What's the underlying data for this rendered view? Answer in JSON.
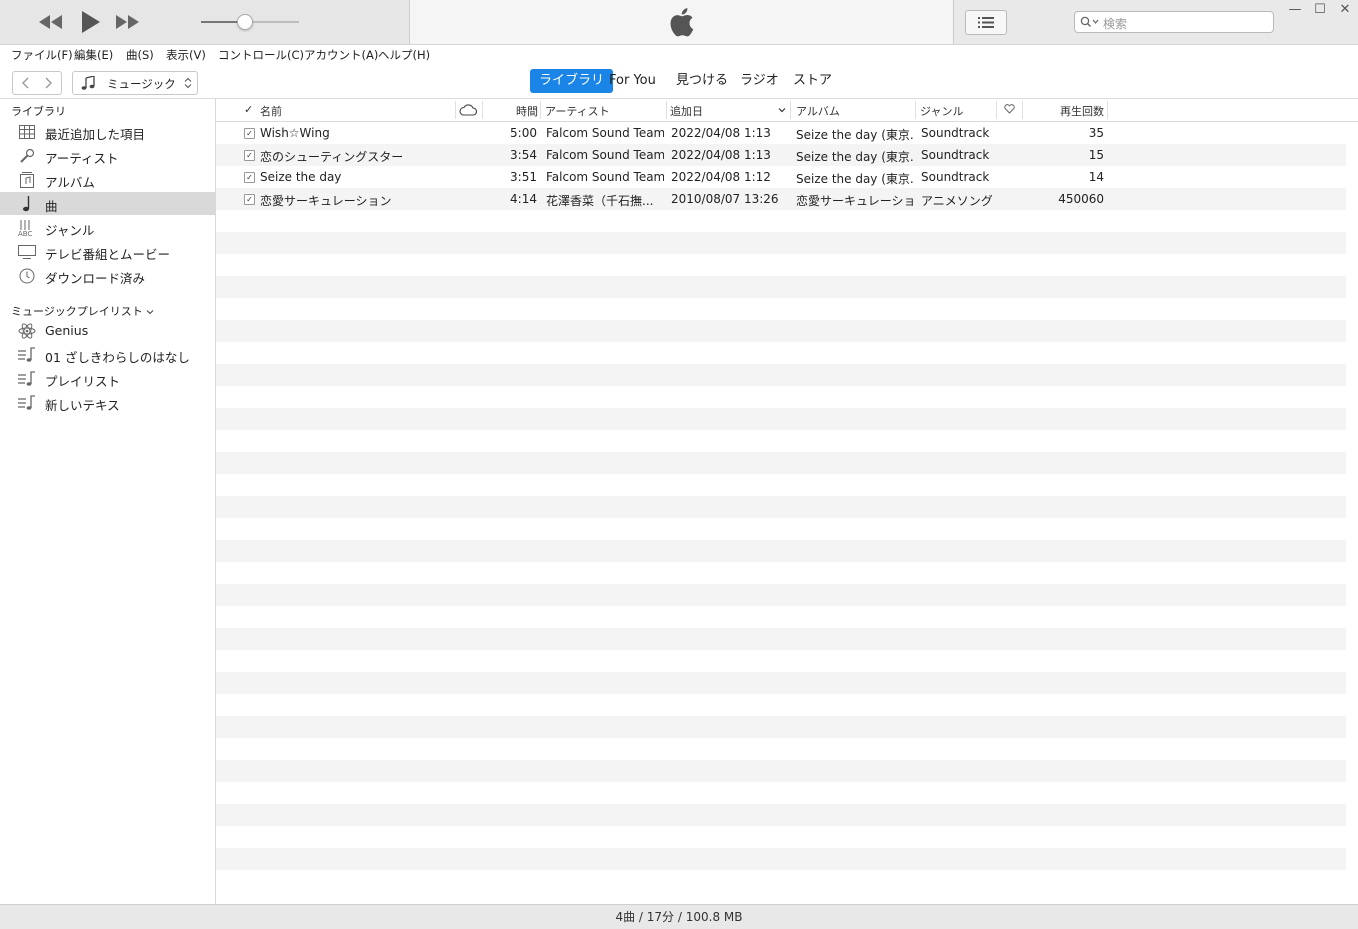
{
  "window": {
    "search_placeholder": "検索",
    "accent_color": "#1a85e6"
  },
  "player": {
    "volume_percent": 44
  },
  "menu": [
    "ファイル(F)",
    "編集(E)",
    "曲(S)",
    "表示(V)",
    "コントロール(C)",
    "アカウント(A)",
    "ヘルプ(H)"
  ],
  "nav": {
    "media_kind": "ミュージック",
    "tabs": [
      "ライブラリ",
      "For You",
      "見つける",
      "ラジオ",
      "ストア"
    ],
    "active_tab": "ライブラリ"
  },
  "sidebar": {
    "library_header": "ライブラリ",
    "library_items": [
      {
        "label": "最近追加した項目",
        "icon": "grid-icon"
      },
      {
        "label": "アーティスト",
        "icon": "microphone-icon"
      },
      {
        "label": "アルバム",
        "icon": "album-icon"
      },
      {
        "label": "曲",
        "icon": "music-note-icon"
      },
      {
        "label": "ジャンル",
        "icon": "genre-icon"
      },
      {
        "label": "テレビ番組とムービー",
        "icon": "tv-icon"
      },
      {
        "label": "ダウンロード済み",
        "icon": "download-clock-icon"
      }
    ],
    "playlists_header": "ミュージックプレイリスト",
    "playlist_items": [
      {
        "label": "Genius",
        "icon": "genius-atom-icon"
      },
      {
        "label": "01 ざしきわらしのはなし",
        "icon": "playlist-icon"
      },
      {
        "label": "プレイリスト",
        "icon": "playlist-icon"
      },
      {
        "label": "新しいテキス",
        "icon": "playlist-icon"
      }
    ]
  },
  "table": {
    "columns": {
      "check": "✓",
      "name": "名前",
      "time": "時間",
      "artist": "アーティスト",
      "added": "追加日",
      "album": "アルバム",
      "genre": "ジャンル",
      "plays": "再生回数"
    },
    "rows": [
      {
        "name": "Wish☆Wing",
        "time": "5:00",
        "artist": "Falcom Sound Team...",
        "added": "2022/04/08 1:13",
        "album": "Seize the day (東京...",
        "genre": "Soundtrack",
        "plays": "35"
      },
      {
        "name": "恋のシューティングスター",
        "time": "3:54",
        "artist": "Falcom Sound Team...",
        "added": "2022/04/08 1:13",
        "album": "Seize the day (東京...",
        "genre": "Soundtrack",
        "plays": "15"
      },
      {
        "name": "Seize the day",
        "time": "3:51",
        "artist": "Falcom Sound Team...",
        "added": "2022/04/08 1:12",
        "album": "Seize the day (東京...",
        "genre": "Soundtrack",
        "plays": "14"
      },
      {
        "name": "恋愛サーキュレーション",
        "time": "4:14",
        "artist": "花澤香菜（千石撫...",
        "added": "2010/08/07 13:26",
        "album": "恋愛サーキュレーション",
        "genre": "アニメソング",
        "plays": "450060"
      }
    ]
  },
  "status": {
    "summary": "4曲 / 17分 / 100.8 MB"
  }
}
